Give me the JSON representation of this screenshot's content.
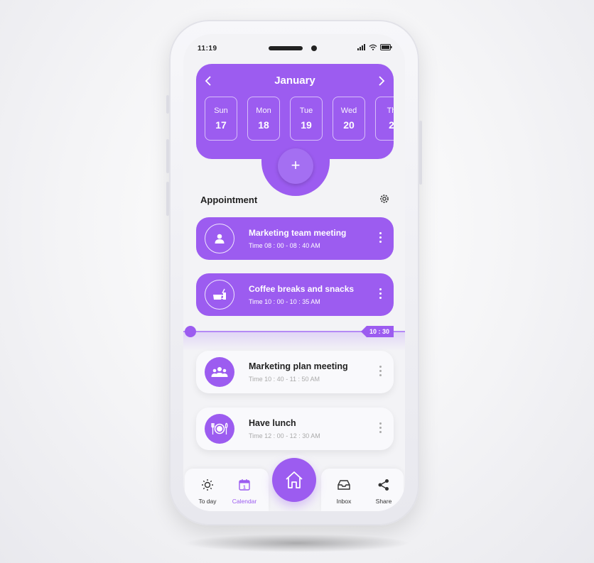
{
  "status_bar": {
    "time": "11:19"
  },
  "calendar": {
    "month": "January",
    "prev_icon": "chevron-left-icon",
    "next_icon": "chevron-right-icon",
    "days": [
      {
        "name": "Sun",
        "date": "17"
      },
      {
        "name": "Mon",
        "date": "18"
      },
      {
        "name": "Tue",
        "date": "19"
      },
      {
        "name": "Wed",
        "date": "20"
      },
      {
        "name": "Th",
        "date": "2"
      }
    ],
    "selected_day": "Mon",
    "add_label": "+"
  },
  "appointments": {
    "title": "Appointment",
    "settings_icon": "gear-icon",
    "items": [
      {
        "title": "Marketing team meeting",
        "time": "Time 08 : 00 - 08 : 40 AM",
        "icon": "person-icon",
        "style": "filled"
      },
      {
        "title": "Coffee breaks and snacks",
        "time": "Time 10 : 00 - 10 : 35 AM",
        "icon": "coffee-icon",
        "style": "filled"
      },
      {
        "title": "Marketing plan meeting",
        "time": "Time 10 : 40 - 11 : 50 AM",
        "icon": "group-icon",
        "style": "light"
      },
      {
        "title": "Have lunch",
        "time": "Time 12 : 00 - 12 : 30 AM",
        "icon": "plate-icon",
        "style": "light"
      }
    ]
  },
  "timeline": {
    "current_time": "10 : 30"
  },
  "tabbar": {
    "today": "To day",
    "calendar": "Calendar",
    "inbox": "Inbox",
    "share": "Share",
    "calendar_icon_day": "1"
  },
  "colors": {
    "accent": "#9c5cf0",
    "background": "#f3f3f6"
  }
}
